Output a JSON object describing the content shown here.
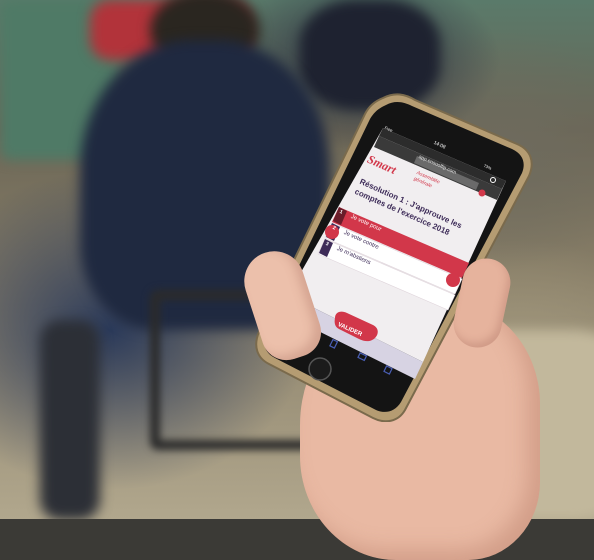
{
  "photo": {
    "subject": "hand-holding-smartphone",
    "accent_color": "#d2374a"
  },
  "phone_screen": {
    "status_bar": {
      "carrier": "Free",
      "time": "14:08",
      "battery": "73%"
    },
    "url_bar": {
      "url": "app.ensoolfip.com"
    },
    "header": {
      "logo_main": "Smart",
      "logo_sub_line1": "Assemblée",
      "logo_sub_line2": "générale"
    },
    "resolution_title_line1": "Résolution 1 : J'approuve les",
    "resolution_title_line2": "comptes de l'exercice 2018",
    "options": [
      {
        "number": "1",
        "label": "Je vote pour",
        "selected": true
      },
      {
        "number": "2",
        "label": "Je vote contre",
        "selected": false
      },
      {
        "number": "3",
        "label": "Je m'abstiens",
        "selected": false
      }
    ],
    "submit_label": "VALIDER"
  }
}
